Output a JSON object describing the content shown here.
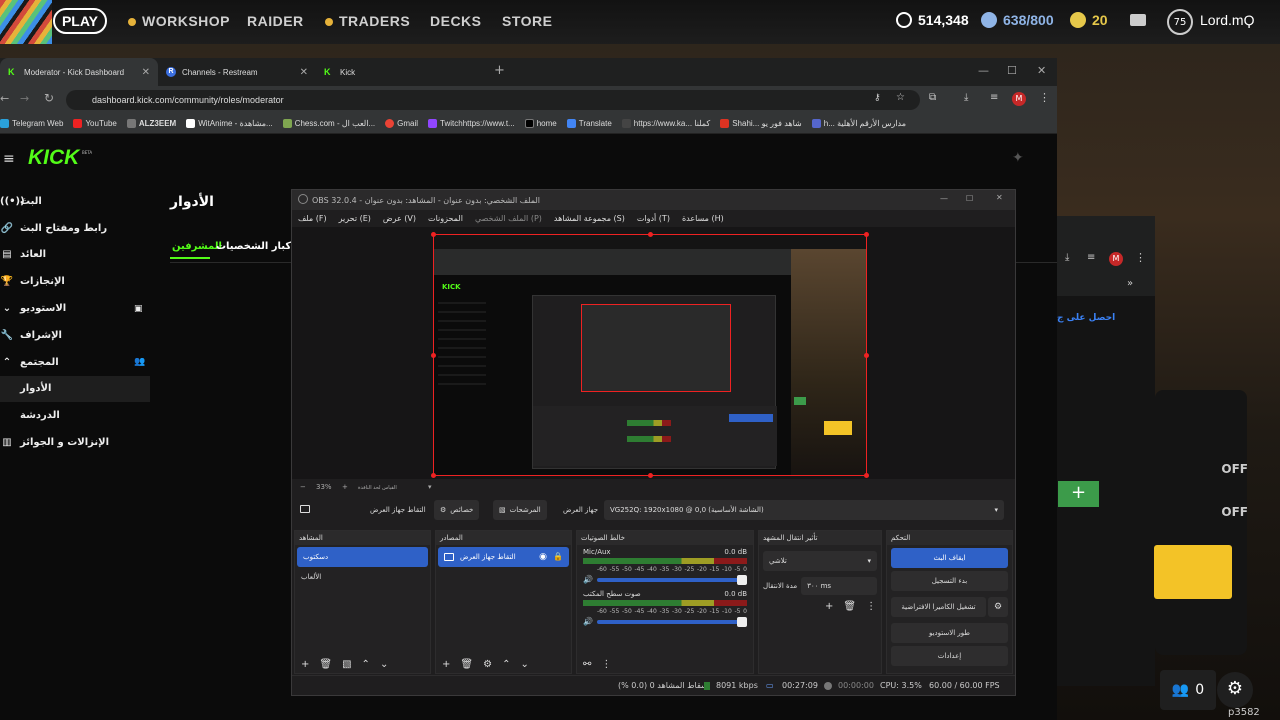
{
  "game": {
    "play_label": "PLAY",
    "nav": [
      "WORKSHOP",
      "RAIDER",
      "TRADERS",
      "DECKS",
      "STORE"
    ],
    "coins": "514,348",
    "capacity": "638/800",
    "tokens": "20",
    "level": "75",
    "username": "Lord.mϘ",
    "friends_count": "0",
    "build": "p3582",
    "off_labels": [
      "OFF",
      "OFF"
    ],
    "side_link": "احصل على ج"
  },
  "browser": {
    "tabs": [
      {
        "favicon": "K",
        "label": "Moderator - Kick Dashboard"
      },
      {
        "favicon": "R",
        "label": "Channels - Restream"
      },
      {
        "favicon": "K",
        "label": "Kick"
      }
    ],
    "url": "dashboard.kick.com/community/roles/moderator",
    "profile_letter": "M",
    "bookmarks": [
      "Telegram Web",
      "YouTube",
      "ALZ3EEM",
      "WitAnime - مشاهدة...",
      "Chess.com - العب ال...",
      "Gmail",
      "Twitchhttps://www.t...",
      "home",
      "Translate",
      "https://www.ka... كملنا",
      "Shahi... شاهد فور يو",
      "h... مدارس الأرقم الأهلية"
    ]
  },
  "kick": {
    "logo": "KICK",
    "beta": "BETA",
    "sidebar": [
      {
        "label": "البث",
        "icon": "((•))"
      },
      {
        "label": "رابط ومفتاح البث",
        "icon": "🔗"
      },
      {
        "label": "العائد",
        "icon": "▤"
      },
      {
        "label": "الإنجازات",
        "icon": "🏆"
      },
      {
        "label": "الاستوديو",
        "icon": "⌄"
      },
      {
        "label": "الإشراف",
        "icon": "🔧"
      },
      {
        "label": "المجتمع",
        "icon": "⌃"
      },
      {
        "label": "الأدوار",
        "icon": ""
      },
      {
        "label": "الدردشة",
        "icon": ""
      },
      {
        "label": "الإنزالات و الجوائز",
        "icon": "▥"
      }
    ],
    "page_title": "الأدوار",
    "role_tabs": [
      "المشرفين",
      "كبار الشخصيات"
    ]
  },
  "obs": {
    "title": "OBS 32.0.4 - الملف الشخصي: بدون عنوان - المشاهد: بدون عنوان",
    "menu": [
      "ملف (F)",
      "تحرير (E)",
      "عرض (V)",
      "المحزونات",
      "الملف الشخصي (P)",
      "مجموعة المشاهد (S)",
      "أدوات (T)",
      "مساعدة (H)"
    ],
    "zoom": "33%",
    "zoom_mode": "القياس لحد النافذة",
    "source_bar": {
      "capture_label": "التقاط جهاز العرض",
      "properties": "خصائص",
      "filters": "المرشحات",
      "display_label": "جهاز العرض",
      "display_value": "VG252Q: 1920x1080 @ 0,0 (الشاشة الأساسية)"
    },
    "docks": {
      "scenes": {
        "title": "المشاهد",
        "items": [
          "دسكتوب",
          "الألعاب"
        ]
      },
      "sources": {
        "title": "المصادر",
        "items": [
          "التقاط جهاز العرض"
        ]
      },
      "mixer": {
        "title": "خالط الصوتيات",
        "channels": [
          {
            "name": "Mic/Aux",
            "db": "0.0 dB"
          },
          {
            "name": "صوت سطح المكتب",
            "db": "0.0 dB"
          }
        ],
        "scale": [
          "-60",
          "-55",
          "-50",
          "-45",
          "-40",
          "-35",
          "-30",
          "-25",
          "-20",
          "-15",
          "-10",
          "-5",
          "0"
        ]
      },
      "transitions": {
        "title": "تأثير انتقال المشهد",
        "type": "تلاشي",
        "duration_label": "مدة الانتقال",
        "duration": "٣٠٠ ms"
      },
      "controls": {
        "title": "التحكم",
        "buttons": [
          "ايقاف البث",
          "بدء التسجيل",
          "تشغيل الكاميرا الافتراضية",
          "طور الاستوديو",
          "إعدادات"
        ]
      }
    },
    "status": {
      "dropped": "إسقاط المشاهد 0 (0.0 %)",
      "bitrate": "8091 kbps",
      "stream_time": "00:27:09",
      "rec_time": "00:00:00",
      "cpu": "CPU: 3.5%",
      "fps": "60.00 / 60.00 FPS"
    }
  },
  "colors": {
    "kick_green": "#53fc18",
    "obs_blue": "#2f61c7",
    "select_red": "#e22222",
    "yellow": "#f3c327"
  }
}
